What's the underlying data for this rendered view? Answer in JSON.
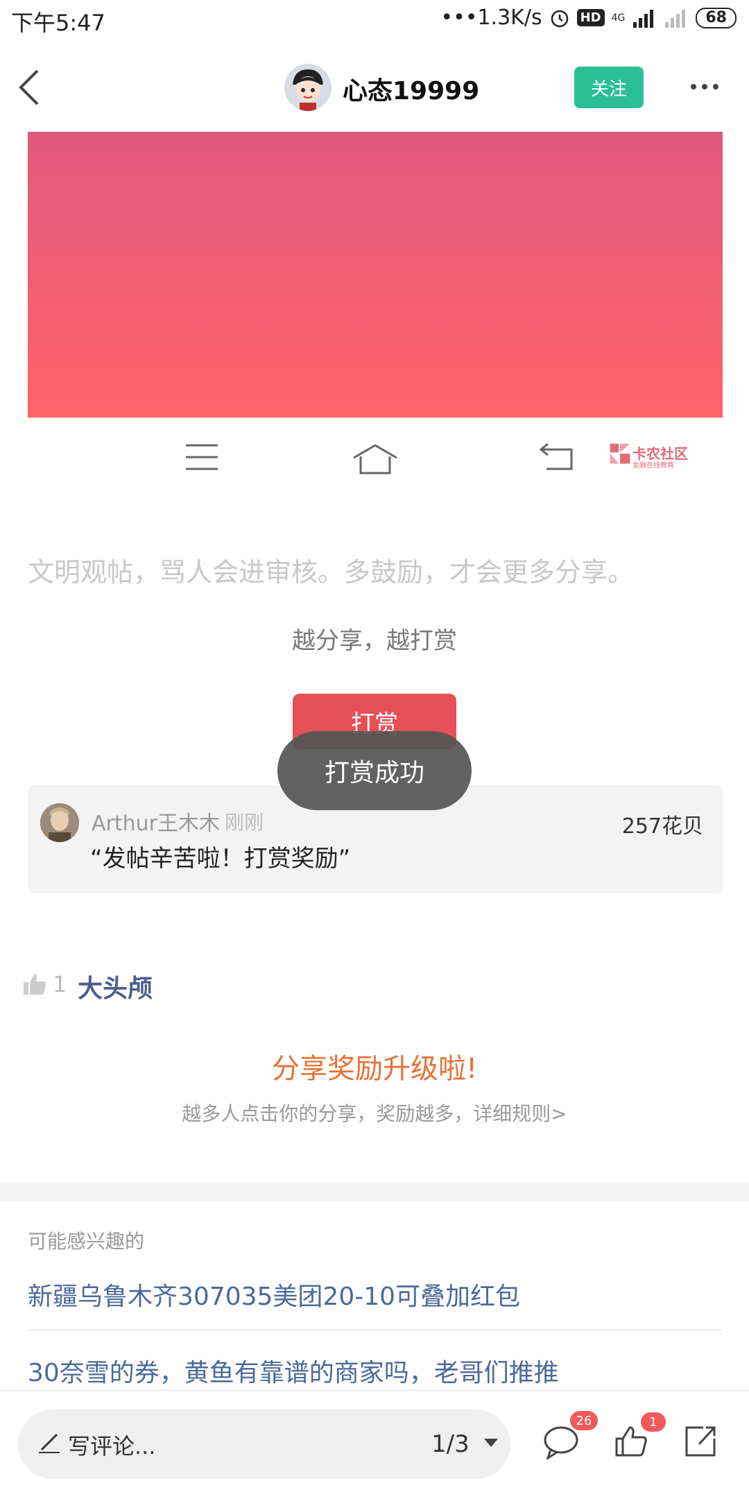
{
  "status_bar": {
    "time": "下午5:47",
    "network_speed": "•••1.3K/s",
    "hd": "HD",
    "network_type": "4G",
    "battery": "68"
  },
  "header": {
    "author_name": "心态19999",
    "follow_label": "关注"
  },
  "watermark": {
    "title": "卡农社区",
    "subtitle": "金融在线教育"
  },
  "post": {
    "civility_notice": "文明观帖，骂人会进审核。多鼓励，才会更多分享。",
    "reward_slogan": "越分享，越打赏",
    "reward_button_label": "打赏",
    "toast_text": "打赏成功"
  },
  "reward_record": {
    "rewarder_name": "Arthur王木木",
    "time": "刚刚",
    "amount": "257花贝",
    "message": "“发帖辛苦啦！打赏奖励”"
  },
  "likes": {
    "count": "1",
    "liker": "大头颅"
  },
  "share_promo": {
    "title": "分享奖励升级啦!",
    "description": "越多人点击你的分享，奖励越多，详细规则>"
  },
  "interest": {
    "title": "可能感兴趣的",
    "items": [
      "新疆乌鲁木齐307035美团20-10可叠加红包",
      "30奈雪的券，黄鱼有靠谱的商家吗，老哥们推推"
    ]
  },
  "bottom_bar": {
    "comment_placeholder": "写评论...",
    "page_indicator": "1/3",
    "comment_count": "26",
    "like_count": "1"
  },
  "colors": {
    "follow": "#2bbf95",
    "reward_button": "#e65156",
    "share_title": "#e77134",
    "link": "#4c6a99",
    "badge": "#f25a5a"
  }
}
